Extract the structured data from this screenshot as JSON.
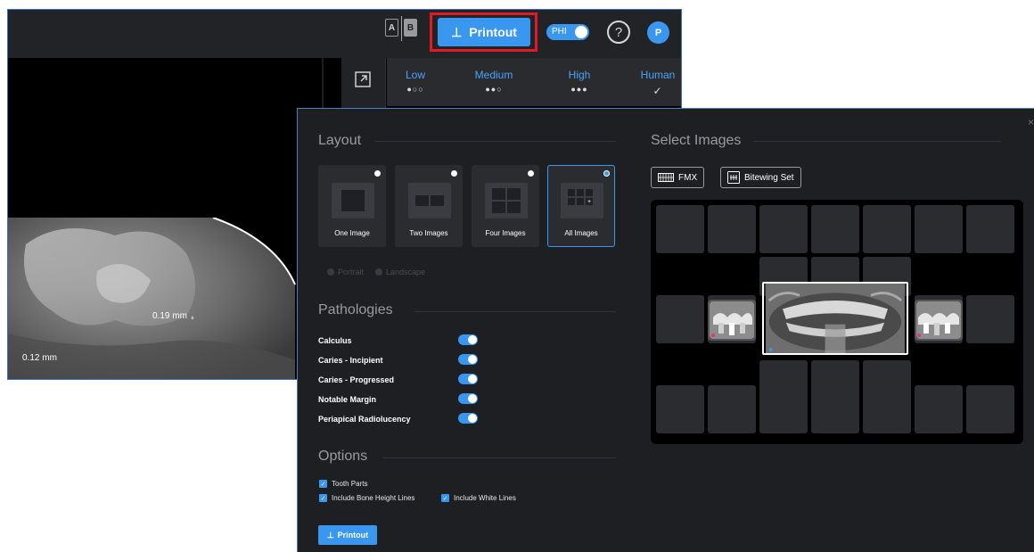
{
  "topbar": {
    "compare_a": "A",
    "compare_b": "B",
    "printout_label": "Printout",
    "phi_label": "PHI",
    "phi_enabled": true,
    "help_glyph": "?",
    "avatar_initial": "P",
    "accent_color": "#3a97f0",
    "highlight_color": "#e01b24"
  },
  "confidence": {
    "levels": [
      {
        "label": "Low",
        "dots": "●○○"
      },
      {
        "label": "Medium",
        "dots": "●●○"
      },
      {
        "label": "High",
        "dots": "●●●"
      },
      {
        "label": "Human",
        "dots": "✓"
      }
    ]
  },
  "viewer": {
    "measurements": [
      "0.19 mm",
      "0.12 mm"
    ]
  },
  "dialog": {
    "layout_title": "Layout",
    "layouts": [
      {
        "label": "One Image",
        "selected": false
      },
      {
        "label": "Two Images",
        "selected": false
      },
      {
        "label": "Four Images",
        "selected": false
      },
      {
        "label": "All Images",
        "selected": true
      }
    ],
    "orientation": {
      "portrait": "Portrait",
      "landscape": "Landscape"
    },
    "pathologies_title": "Pathologies",
    "pathologies": [
      {
        "label": "Calculus",
        "enabled": true
      },
      {
        "label": "Caries - Incipient",
        "enabled": true
      },
      {
        "label": "Caries - Progressed",
        "enabled": true
      },
      {
        "label": "Notable Margin",
        "enabled": true
      },
      {
        "label": "Periapical Radiolucency",
        "enabled": true
      }
    ],
    "options_title": "Options",
    "options": {
      "tooth_parts": "Tooth Parts",
      "bone_height": "Include Bone Height Lines",
      "white_lines": "Include White Lines"
    },
    "printout_label": "Printout",
    "select_images_title": "Select Images",
    "fmx_label": "FMX",
    "bitewing_label": "Bitewing Set",
    "close_glyph": "×"
  }
}
